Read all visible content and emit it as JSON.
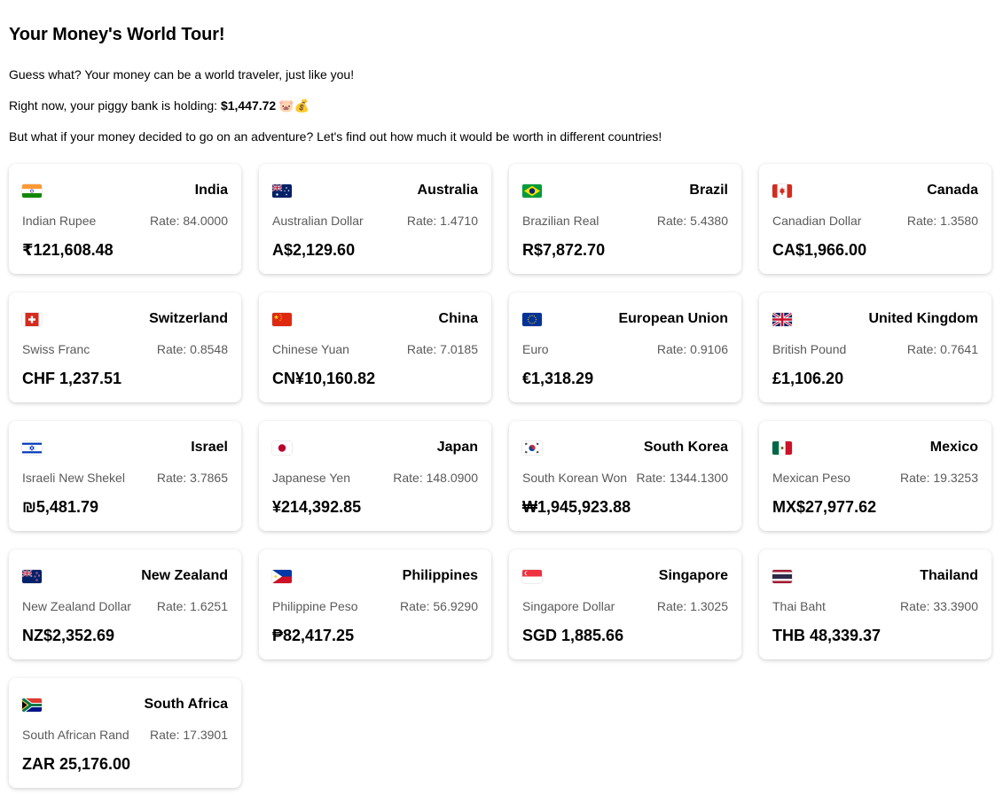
{
  "header": {
    "title": "Your Money's World Tour!",
    "line1": "Guess what? Your money can be a world traveler, just like you!",
    "line2_prefix": "Right now, your piggy bank is holding: ",
    "balance": "$1,447.72",
    "line2_emoji": "🐷💰",
    "line3": "But what if your money decided to go on an adventure? Let's find out how much it would be worth in different countries!"
  },
  "cards": [
    {
      "country": "India",
      "currency": "Indian Rupee",
      "rate": "Rate: 84.0000",
      "amount": "₹121,608.48",
      "flag": "flag-india-icon"
    },
    {
      "country": "Australia",
      "currency": "Australian Dollar",
      "rate": "Rate: 1.4710",
      "amount": "A$2,129.60",
      "flag": "flag-australia-icon"
    },
    {
      "country": "Brazil",
      "currency": "Brazilian Real",
      "rate": "Rate: 5.4380",
      "amount": "R$7,872.70",
      "flag": "flag-brazil-icon"
    },
    {
      "country": "Canada",
      "currency": "Canadian Dollar",
      "rate": "Rate: 1.3580",
      "amount": "CA$1,966.00",
      "flag": "flag-canada-icon"
    },
    {
      "country": "Switzerland",
      "currency": "Swiss Franc",
      "rate": "Rate: 0.8548",
      "amount": "CHF 1,237.51",
      "flag": "flag-switzerland-icon"
    },
    {
      "country": "China",
      "currency": "Chinese Yuan",
      "rate": "Rate: 7.0185",
      "amount": "CN¥10,160.82",
      "flag": "flag-china-icon"
    },
    {
      "country": "European Union",
      "currency": "Euro",
      "rate": "Rate: 0.9106",
      "amount": "€1,318.29",
      "flag": "flag-eu-icon"
    },
    {
      "country": "United Kingdom",
      "currency": "British Pound",
      "rate": "Rate: 0.7641",
      "amount": "£1,106.20",
      "flag": "flag-uk-icon"
    },
    {
      "country": "Israel",
      "currency": "Israeli New Shekel",
      "rate": "Rate: 3.7865",
      "amount": "₪5,481.79",
      "flag": "flag-israel-icon"
    },
    {
      "country": "Japan",
      "currency": "Japanese Yen",
      "rate": "Rate: 148.0900",
      "amount": "¥214,392.85",
      "flag": "flag-japan-icon"
    },
    {
      "country": "South Korea",
      "currency": "South Korean Won",
      "rate": "Rate: 1344.1300",
      "amount": "₩1,945,923.88",
      "flag": "flag-south-korea-icon"
    },
    {
      "country": "Mexico",
      "currency": "Mexican Peso",
      "rate": "Rate: 19.3253",
      "amount": "MX$27,977.62",
      "flag": "flag-mexico-icon"
    },
    {
      "country": "New Zealand",
      "currency": "New Zealand Dollar",
      "rate": "Rate: 1.6251",
      "amount": "NZ$2,352.69",
      "flag": "flag-new-zealand-icon"
    },
    {
      "country": "Philippines",
      "currency": "Philippine Peso",
      "rate": "Rate: 56.9290",
      "amount": "₱82,417.25",
      "flag": "flag-philippines-icon"
    },
    {
      "country": "Singapore",
      "currency": "Singapore Dollar",
      "rate": "Rate: 1.3025",
      "amount": "SGD 1,885.66",
      "flag": "flag-singapore-icon"
    },
    {
      "country": "Thailand",
      "currency": "Thai Baht",
      "rate": "Rate: 33.3900",
      "amount": "THB 48,339.37",
      "flag": "flag-thailand-icon"
    },
    {
      "country": "South Africa",
      "currency": "South African Rand",
      "rate": "Rate: 17.3901",
      "amount": "ZAR 25,176.00",
      "flag": "flag-south-africa-icon"
    }
  ]
}
